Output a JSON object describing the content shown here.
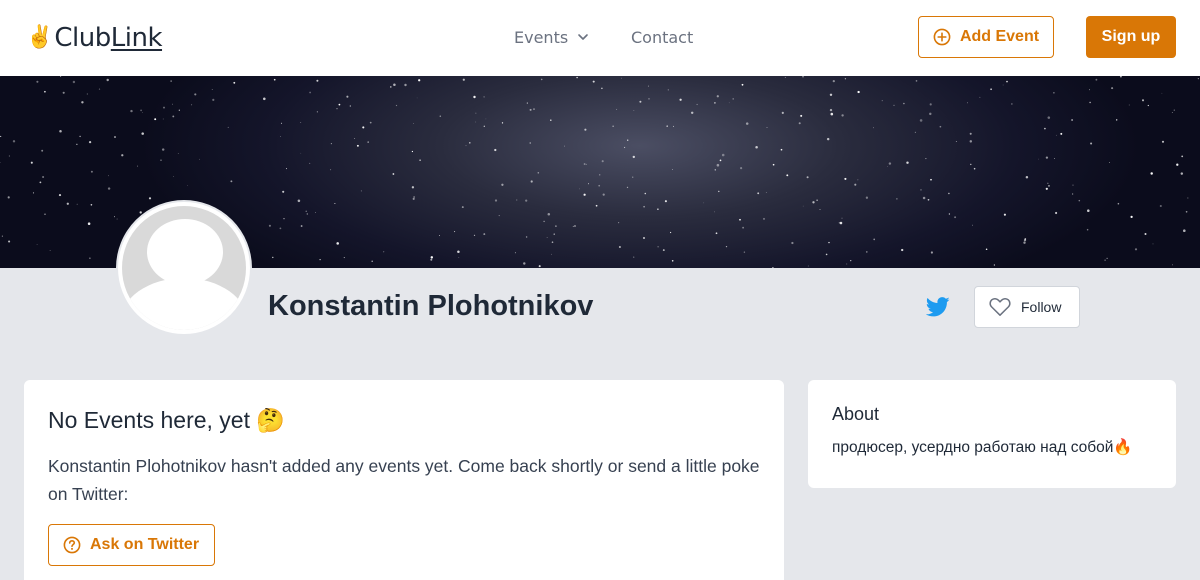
{
  "header": {
    "logo": {
      "emoji": "✌️",
      "text_plain": "Club",
      "text_underlined": "Link"
    },
    "nav": {
      "events_label": "Events",
      "contact_label": "Contact"
    },
    "add_event_label": "Add Event",
    "signup_label": "Sign up"
  },
  "profile": {
    "name": "Konstantin Plohotnikov",
    "follow_label": "Follow"
  },
  "events_card": {
    "title": "No Events here, yet",
    "title_emoji": "🤔",
    "message": "Konstantin Plohotnikov hasn't added any events yet. Come back shortly or send a little poke on Twitter:",
    "ask_button_label": "Ask on Twitter"
  },
  "about_card": {
    "title": "About",
    "text": "продюсер, усердно работаю над собой",
    "text_emoji": "🔥"
  },
  "icons": {
    "logo": "victory-hand-icon",
    "events_dropdown": "chevron-down-icon",
    "add_event": "plus-circle-icon",
    "twitter": "twitter-bird-icon",
    "follow": "heart-icon",
    "ask": "question-circle-icon"
  },
  "colors": {
    "accent": "#d97706",
    "page_bg": "#e5e7eb",
    "twitter": "#1d9bf0",
    "card_bg": "#ffffff"
  }
}
